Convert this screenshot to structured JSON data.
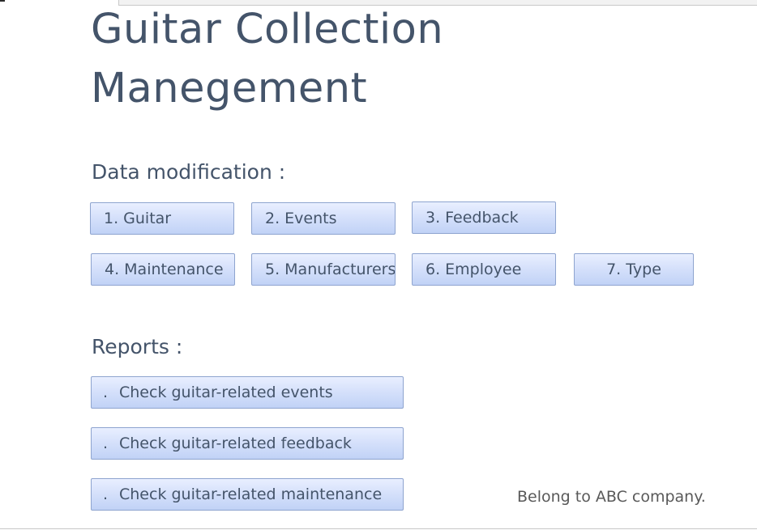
{
  "title": {
    "line1": "Guitar Collection",
    "line2": "Manegement"
  },
  "data_modification": {
    "label": "Data modification :",
    "buttons": [
      {
        "label": "1. Guitar"
      },
      {
        "label": "2. Events"
      },
      {
        "label": "3. Feedback"
      },
      {
        "label": "4. Maintenance"
      },
      {
        "label": "5. Manufacturers"
      },
      {
        "label": "6. Employee"
      },
      {
        "label": "7. Type"
      }
    ]
  },
  "reports": {
    "label": "Reports :",
    "bullet": ".",
    "buttons": [
      {
        "label": "Check guitar-related events"
      },
      {
        "label": "Check guitar-related feedback"
      },
      {
        "label": "Check guitar-related maintenance"
      }
    ]
  },
  "footer": {
    "note": "Belong to ABC company."
  }
}
